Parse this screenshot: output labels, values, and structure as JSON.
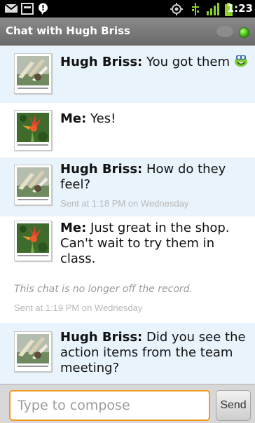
{
  "status_bar": {
    "time": "1:23",
    "icons": [
      "mail-icon",
      "screen-icon",
      "chat-bubble-icon",
      "gps-icon",
      "usb-icon",
      "signal-icon",
      "battery-icon"
    ]
  },
  "title_bar": {
    "title": "Chat with Hugh Briss",
    "presence_color": "#35b10c"
  },
  "messages": [
    {
      "who": "them",
      "sender": "Hugh Briss:",
      "text": " You got them",
      "emoticon": "happy-face-icon",
      "timestamp": ""
    },
    {
      "who": "me",
      "sender": "Me:",
      "text": " Yes!",
      "timestamp": ""
    },
    {
      "who": "them",
      "sender": "Hugh Briss:",
      "text": " How do they feel?",
      "timestamp": "Sent at 1:18 PM on Wednesday"
    },
    {
      "who": "me",
      "sender": "Me:",
      "text": " Just great in the shop. Can't wait to try them in class.",
      "timestamp": ""
    },
    {
      "who": "them",
      "sender": "Hugh Briss:",
      "text": " Did you see the action items from the team meeting?",
      "timestamp": ""
    }
  ],
  "system": {
    "note": "This chat is no longer off the record.",
    "timestamp": "Sent at 1:19 PM on Wednesday"
  },
  "composer": {
    "placeholder": "Type to compose",
    "send_label": "Send"
  },
  "colors": {
    "their_bubble": "#e8f3fb",
    "accent_orange": "#f19a1e"
  }
}
